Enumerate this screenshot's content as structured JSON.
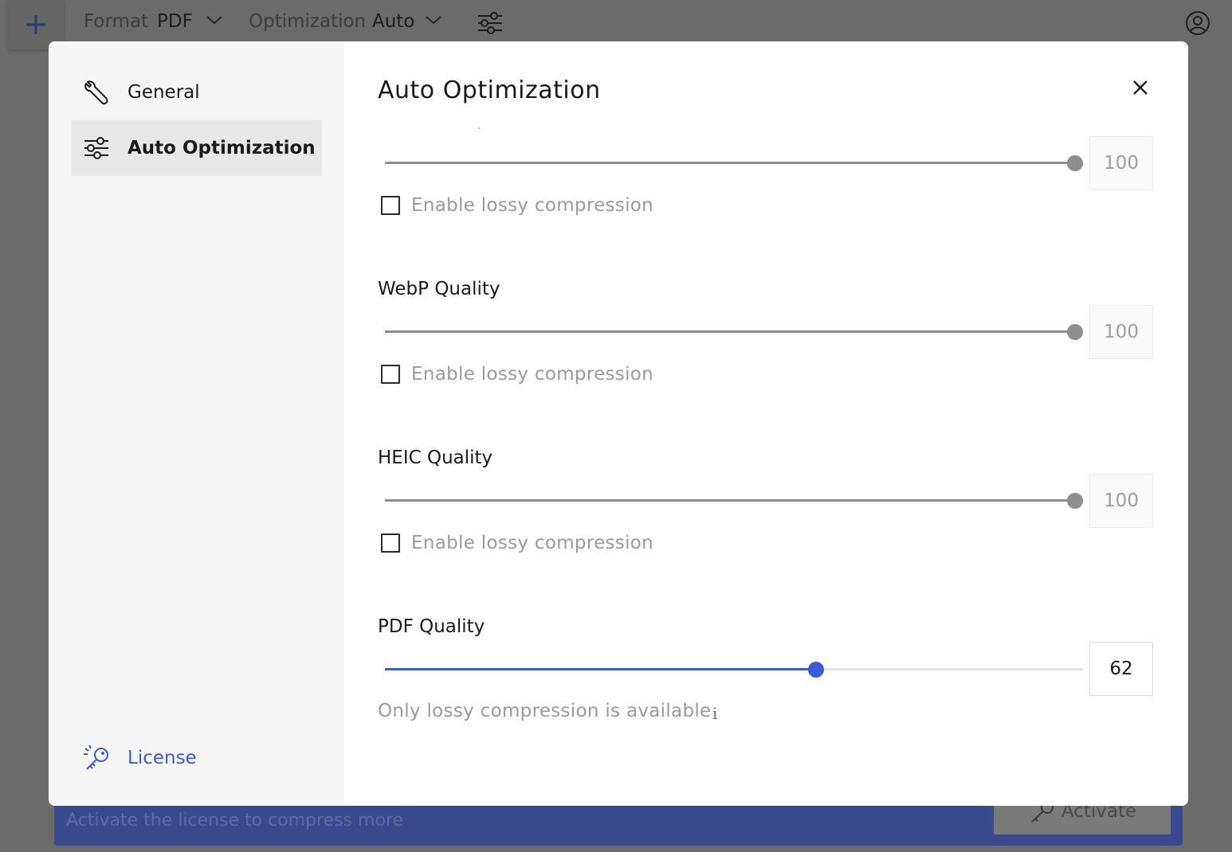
{
  "toolbar": {
    "add_icon": "plus-icon",
    "format_label": "Format",
    "format_value": "PDF",
    "optimization_label": "Optimization",
    "optimization_value": "Auto",
    "settings_icon": "sliders-icon",
    "account_icon": "user-circle-icon"
  },
  "banner": {
    "text": "Activate the license to compress more",
    "activate_label": "Activate"
  },
  "sidebar": {
    "items": [
      {
        "label": "General",
        "icon": "wrench-icon",
        "active": false
      },
      {
        "label": "Auto Optimization",
        "icon": "sliders-icon",
        "active": true
      }
    ],
    "license": {
      "label": "License",
      "icon": "key-icon"
    }
  },
  "panel": {
    "title": "Auto Optimization",
    "close_icon": "close-icon",
    "sections": [
      {
        "label": "",
        "value": 100,
        "lossy_label": "Enable lossy compression",
        "lossy_checked": false
      },
      {
        "label": "WebP Quality",
        "value": 100,
        "lossy_label": "Enable lossy compression",
        "lossy_checked": false
      },
      {
        "label": "HEIC Quality",
        "value": 100,
        "lossy_label": "Enable lossy compression",
        "lossy_checked": false
      },
      {
        "label": "PDF Quality",
        "value": 62,
        "note": "Only lossy compression is available"
      }
    ]
  },
  "colors": {
    "accent": "#3a5bd9",
    "disabled_slider": "#8e8e8e",
    "banner": "#3b4a8e"
  }
}
